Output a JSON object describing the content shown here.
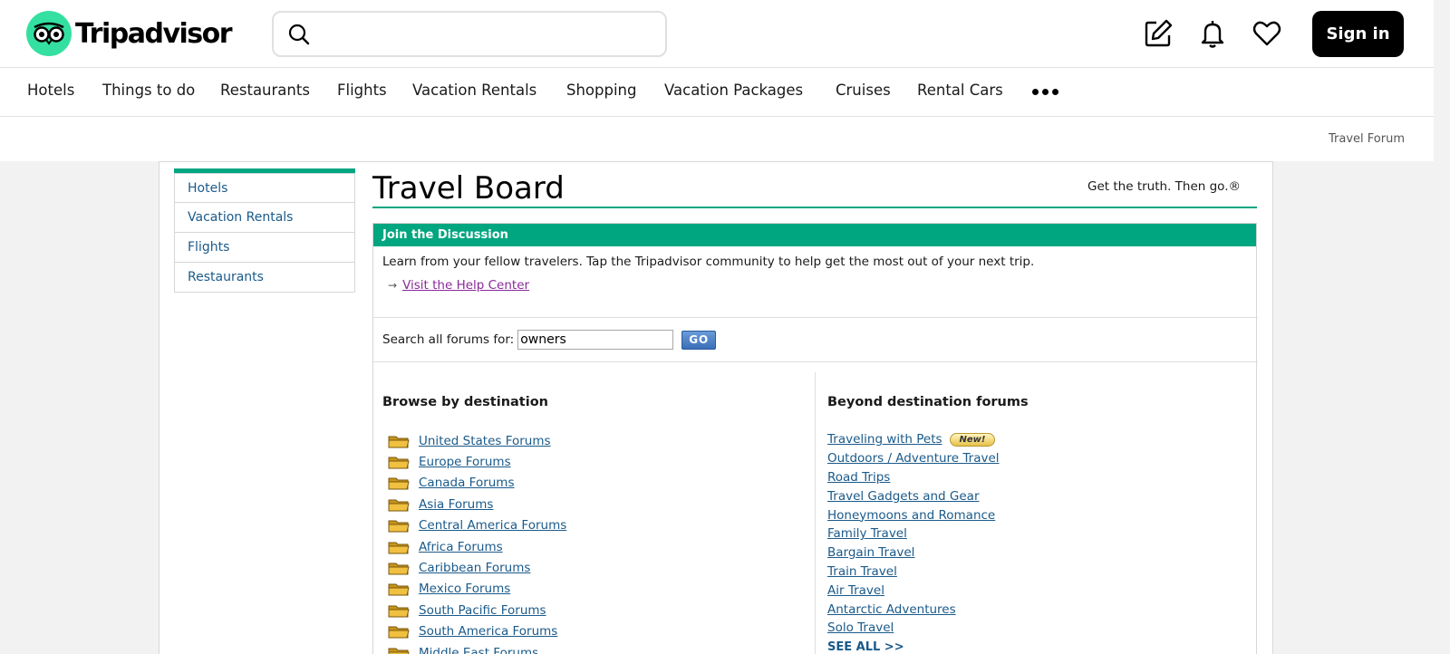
{
  "header": {
    "brand": "Tripadvisor",
    "search_placeholder": "",
    "signin_label": "Sign in"
  },
  "nav": {
    "items": [
      "Hotels",
      "Things to do",
      "Restaurants",
      "Flights",
      "Vacation Rentals",
      "Shopping",
      "Vacation Packages",
      "Cruises",
      "Rental Cars"
    ]
  },
  "breadcrumb": "Travel Forum",
  "sidebar": {
    "items": [
      "Hotels",
      "Vacation Rentals",
      "Flights",
      "Restaurants"
    ]
  },
  "main": {
    "title": "Travel Board",
    "tagline": "Get the truth. Then go.®",
    "box_title": "Join the Discussion",
    "intro": "Learn from your fellow travelers. Tap the Tripadvisor community to help get the most out of your next trip.",
    "help_link": "Visit the Help Center",
    "search_label": "Search all forums for:",
    "search_value": "owners",
    "go_label": "GO"
  },
  "browse": {
    "heading": "Browse by destination",
    "items": [
      "United States Forums",
      "Europe Forums",
      "Canada Forums",
      "Asia Forums",
      "Central America Forums",
      "Africa Forums",
      "Caribbean Forums",
      "Mexico Forums",
      "South Pacific Forums",
      "South America Forums",
      "Middle East Forums"
    ]
  },
  "beyond": {
    "heading": "Beyond destination forums",
    "items": [
      "Traveling with Pets",
      "Outdoors / Adventure Travel",
      "Road Trips",
      "Travel Gadgets and Gear",
      "Honeymoons and Romance",
      "Family Travel",
      "Bargain Travel",
      "Train Travel",
      "Air Travel",
      "Antarctic Adventures",
      "Solo Travel"
    ],
    "new_badge": "New!",
    "see_all": "SEE ALL >>"
  },
  "colors": {
    "brand_green": "#00a680",
    "logo_mint": "#34e0a1",
    "link_blue": "#1a5a8a",
    "visited_purple": "#8a2a9a"
  }
}
